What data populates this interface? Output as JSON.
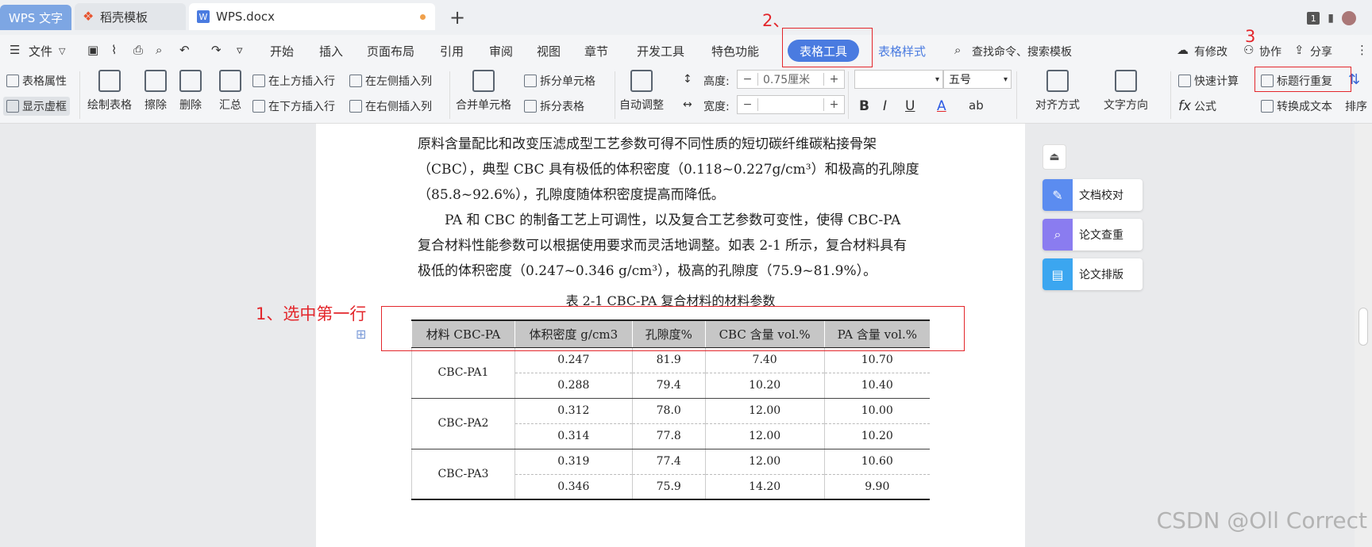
{
  "tabs": {
    "app": "WPS 文字",
    "template": "稻壳模板",
    "doc": "WPS.docx",
    "new": "+",
    "window_count": "1"
  },
  "menu": {
    "file": "文件",
    "items": [
      "开始",
      "插入",
      "页面布局",
      "引用",
      "审阅",
      "视图",
      "章节",
      "开发工具",
      "特色功能"
    ],
    "active": "表格工具",
    "table_style": "表格样式",
    "search": "查找命令、搜索模板",
    "modify": "有修改",
    "collab": "协作",
    "share": "分享"
  },
  "ribbon": {
    "table_props": "表格属性",
    "show_grid": "显示虚框",
    "draw_table": "绘制表格",
    "erase": "擦除",
    "delete": "删除",
    "summary": "汇总",
    "insert_above": "在上方插入行",
    "insert_below": "在下方插入行",
    "insert_left": "在左侧插入列",
    "insert_right": "在右侧插入列",
    "merge": "合并单元格",
    "split_cell": "拆分单元格",
    "split_table": "拆分表格",
    "auto_fit": "自动调整",
    "height_label": "高度:",
    "height_value": "0.75厘米",
    "width_label": "宽度:",
    "width_value": "",
    "font_size": "五号",
    "bold": "B",
    "italic": "I",
    "underline": "U",
    "font_color": "A",
    "align": "对齐方式",
    "text_dir": "文字方向",
    "quick_calc": "快速计算",
    "formula": "公式",
    "repeat_header": "标题行重复",
    "convert_text": "转换成文本",
    "sort": "排序"
  },
  "annotations": {
    "step1": "1、选中第一行",
    "step2": "2、",
    "step3": "3"
  },
  "document": {
    "para1_l1": "原料含量配比和改变压滤成型工艺参数可得不同性质的短切碳纤维碳粘接骨架",
    "para1_l2": "（CBC），典型 CBC 具有极低的体积密度（0.118~0.227g/cm³）和极高的孔隙度",
    "para1_l3": "（85.8~92.6%），孔隙度随体积密度提高而降低。",
    "para2_l1": "PA 和 CBC 的制备工艺上可调性，以及复合工艺参数可变性，使得 CBC-PA",
    "para2_l2": "复合材料性能参数可以根据使用要求而灵活地调整。如表 2-1 所示，复合材料具有",
    "para2_l3": "极低的体积密度（0.247~0.346 g/cm³），极高的孔隙度（75.9~81.9%）。",
    "caption": "表 2-1 CBC-PA 复合材料的材料参数"
  },
  "table": {
    "headers": [
      "材料 CBC-PA",
      "体积密度 g/cm3",
      "孔隙度%",
      "CBC 含量 vol.%",
      "PA 含量 vol.%"
    ],
    "groups": [
      {
        "name": "CBC-PA1",
        "rows": [
          [
            "0.247",
            "81.9",
            "7.40",
            "10.70"
          ],
          [
            "0.288",
            "79.4",
            "10.20",
            "10.40"
          ]
        ]
      },
      {
        "name": "CBC-PA2",
        "rows": [
          [
            "0.312",
            "78.0",
            "12.00",
            "10.00"
          ],
          [
            "0.314",
            "77.8",
            "12.00",
            "10.20"
          ]
        ]
      },
      {
        "name": "CBC-PA3",
        "rows": [
          [
            "0.319",
            "77.4",
            "12.00",
            "10.60"
          ],
          [
            "0.346",
            "75.9",
            "14.20",
            "9.90"
          ]
        ]
      }
    ]
  },
  "side": {
    "proofread": "文档校对",
    "check": "论文查重",
    "layout": "论文排版"
  },
  "watermark": "CSDN @Oll Correct",
  "colors": {
    "accent": "#4a7be0",
    "annotation": "#e3262b",
    "header_fill": "#c6c6c6"
  }
}
